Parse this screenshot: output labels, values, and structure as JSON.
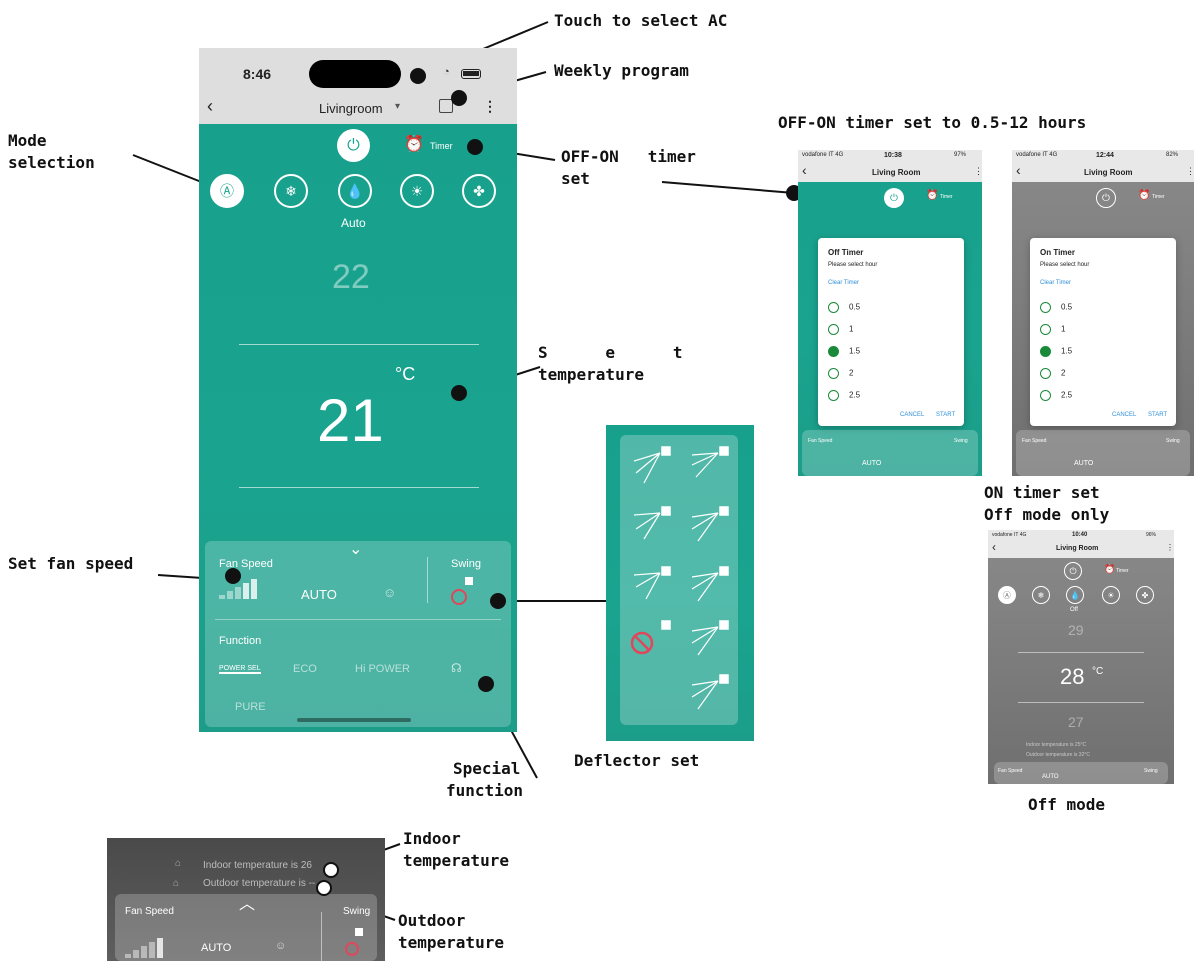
{
  "annotations": {
    "touch_ac": "Touch to select AC",
    "weekly_program": "Weekly program",
    "mode_selection_1": "Mode",
    "mode_selection_2": "selection",
    "offon_timer_set_1": "OFF-ON   timer",
    "offon_timer_set_2": "set",
    "offon_hours": "OFF-ON timer set to 0.5-12 hours",
    "set_temp_1": "S      e      t",
    "set_temp_2": "temperature",
    "set_fan_speed": "Set fan speed",
    "deflector_set": "Deflector set",
    "special_function_1": "Special",
    "special_function_2": "function",
    "on_timer_off_1": "ON timer set",
    "on_timer_off_2": "Off mode only",
    "off_mode": "Off mode",
    "indoor_temp_1": "Indoor",
    "indoor_temp_2": "temperature",
    "outdoor_temp_1": "Outdoor",
    "outdoor_temp_2": "temperature"
  },
  "main_phone": {
    "time": "8:46",
    "room": "Livingroom",
    "timer_label": "Timer",
    "mode_label": "Auto",
    "upper_temp": "22",
    "set_temp": "21",
    "unit": "°C",
    "fan_speed_label": "Fan Speed",
    "fan_value": "AUTO",
    "swing_label": "Swing",
    "function_label": "Function",
    "functions": [
      "POWER SEL",
      "ECO",
      "Hi POWER",
      "PURE"
    ]
  },
  "off_timer_phone": {
    "carrier": "vodafone IT  4G",
    "time": "10:38",
    "battery": "97%",
    "room": "Living Room",
    "timer_label": "Timer",
    "dialog_title": "Off Timer",
    "dialog_sub": "Please select hour",
    "clear": "Clear Timer",
    "options": [
      "0.5",
      "1",
      "1.5",
      "2",
      "2.5"
    ],
    "selected": "1.5",
    "cancel": "CANCEL",
    "start": "START",
    "fan_speed_label": "Fan Speed",
    "fan_value": "AUTO",
    "swing_label": "Swing"
  },
  "on_timer_phone": {
    "carrier": "vodafone IT  4G",
    "time": "12:44",
    "battery": "82%",
    "room": "Living Room",
    "timer_label": "Timer",
    "dialog_title": "On Timer",
    "dialog_sub": "Please select hour",
    "clear": "Clear Timer",
    "options": [
      "0.5",
      "1",
      "1.5",
      "2",
      "2.5"
    ],
    "selected": "1.5",
    "cancel": "CANCEL",
    "start": "START",
    "fan_speed_label": "Fan Speed",
    "fan_value": "AUTO",
    "swing_label": "Swing"
  },
  "off_mode_phone": {
    "carrier": "vodafone IT  4G",
    "time": "10:40",
    "battery": "96%",
    "room": "Living Room",
    "timer_label": "Timer",
    "mode_label": "Off",
    "upper_temp": "29",
    "set_temp": "28",
    "unit": "°C",
    "lower_temp": "27",
    "indoor": "Indoor temperature is 25°C",
    "outdoor": "Outdoor temperature is 32°C",
    "fan_speed_label": "Fan Speed",
    "fan_value": "AUTO",
    "swing_label": "Swing"
  },
  "bottom_crop": {
    "indoor": "Indoor temperature is 26",
    "outdoor": "Outdoor temperature is --",
    "fan_speed_label": "Fan Speed",
    "fan_value": "AUTO",
    "swing_label": "Swing"
  },
  "colors": {
    "teal": "#1aa48f",
    "radio_green": "#1a8a3a",
    "link_blue": "#2f8fd8"
  }
}
